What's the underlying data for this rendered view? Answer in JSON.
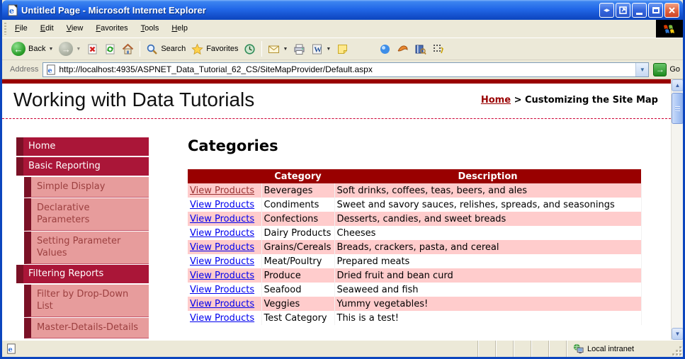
{
  "colors": {
    "maroon": "#990000",
    "crimson": "#AA1638",
    "darkstrip": "#7A1126",
    "pink_item": "#E79C9C",
    "pink_row": "#FFCCCC",
    "winborder": "#0C46BE",
    "link_blue": "#0000EE",
    "visited_link": "#993333"
  },
  "window": {
    "title": "Untitled Page - Microsoft Internet Explorer",
    "menu": [
      "File",
      "Edit",
      "View",
      "Favorites",
      "Tools",
      "Help"
    ]
  },
  "toolbar": {
    "back_label": "Back",
    "search_label": "Search",
    "favorites_label": "Favorites"
  },
  "address_bar": {
    "label": "Address",
    "url": "http://localhost:4935/ASPNET_Data_Tutorial_62_CS/SiteMapProvider/Default.aspx",
    "go_label": "Go"
  },
  "page": {
    "site_title": "Working with Data Tutorials",
    "breadcrumb": {
      "home": "Home",
      "separator": " > ",
      "current": "Customizing the Site Map"
    },
    "heading": "Categories",
    "sidebar": [
      {
        "label": "Home"
      },
      {
        "label": "Basic Reporting"
      },
      {
        "label": "Simple Display"
      },
      {
        "label": "Declarative Parameters"
      },
      {
        "label": "Setting Parameter Values"
      },
      {
        "label": "Filtering Reports"
      },
      {
        "label": "Filter by Drop-Down List"
      },
      {
        "label": "Master-Details-Details"
      }
    ],
    "table": {
      "link_label": "View Products",
      "headers": [
        "",
        "Category",
        "Description"
      ],
      "rows": [
        {
          "category": "Beverages",
          "description": "Soft drinks, coffees, teas, beers, and ales"
        },
        {
          "category": "Condiments",
          "description": "Sweet and savory sauces, relishes, spreads, and seasonings"
        },
        {
          "category": "Confections",
          "description": "Desserts, candies, and sweet breads"
        },
        {
          "category": "Dairy Products",
          "description": "Cheeses"
        },
        {
          "category": "Grains/Cereals",
          "description": "Breads, crackers, pasta, and cereal"
        },
        {
          "category": "Meat/Poultry",
          "description": "Prepared meats"
        },
        {
          "category": "Produce",
          "description": "Dried fruit and bean curd"
        },
        {
          "category": "Seafood",
          "description": "Seaweed and fish"
        },
        {
          "category": "Veggies",
          "description": "Yummy vegetables!"
        },
        {
          "category": "Test Category",
          "description": "This is a test!"
        }
      ]
    }
  },
  "statusbar": {
    "zone_label": "Local intranet"
  }
}
